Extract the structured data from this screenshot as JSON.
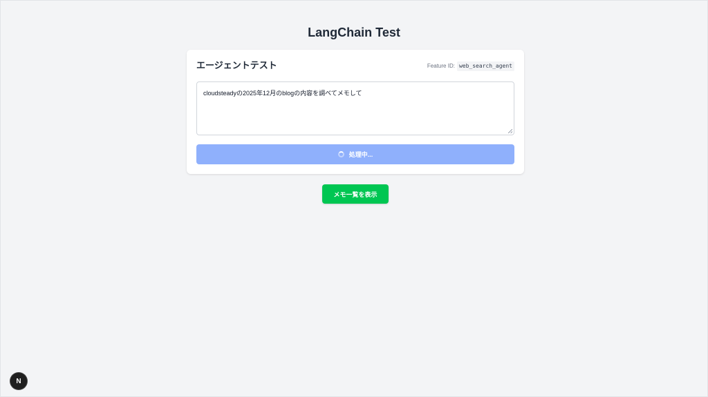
{
  "app": {
    "title": "LangChain Test"
  },
  "card": {
    "title": "エージェントテスト",
    "feature_label": "Feature ID:",
    "feature_id": "web_search_agent",
    "prompt_value": "cloudsteadyの2025年12月のblogの内容を調べてメモして",
    "submit_label": "処理中...",
    "submit_state": "loading"
  },
  "actions": {
    "memo_list_label": "メモ一覧を表示"
  },
  "dev_badge": {
    "letter": "N",
    "icon": "nextjs-icon"
  },
  "colors": {
    "background": "#f3f4f6",
    "submit_disabled": "#8fb0fc",
    "memo_button": "#00c652",
    "title_text": "#1f2937"
  }
}
